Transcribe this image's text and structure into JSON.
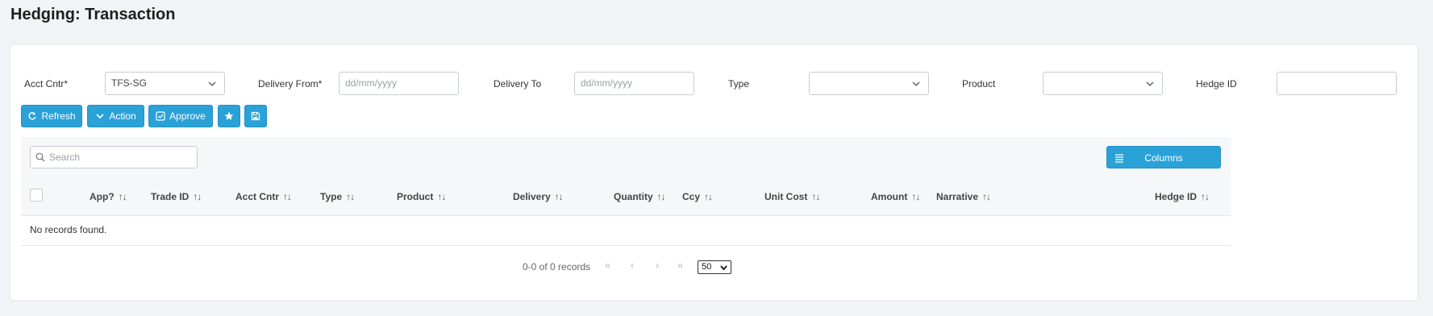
{
  "page": {
    "title": "Hedging: Transaction"
  },
  "filters": {
    "acct_cntr": {
      "label": "Acct Cntr*",
      "value": "TFS-SG"
    },
    "delivery_from": {
      "label": "Delivery From*",
      "placeholder": "dd/mm/yyyy"
    },
    "delivery_to": {
      "label": "Delivery To",
      "placeholder": "dd/mm/yyyy"
    },
    "type": {
      "label": "Type",
      "value": ""
    },
    "product": {
      "label": "Product",
      "value": ""
    },
    "hedge_id": {
      "label": "Hedge ID",
      "value": ""
    }
  },
  "toolbar": {
    "refresh": "Refresh",
    "action": "Action",
    "approve": "Approve",
    "favorite_icon": "star-icon",
    "save_icon": "save-icon"
  },
  "grid": {
    "search_placeholder": "Search",
    "columns_button": "Columns",
    "columns": [
      "App?",
      "Trade ID",
      "Acct Cntr",
      "Type",
      "Product",
      "Delivery",
      "Quantity",
      "Ccy",
      "Unit Cost",
      "Amount",
      "Narrative",
      "Hedge ID"
    ],
    "empty_message": "No records found.",
    "sortable": [
      true,
      true,
      true,
      true,
      true,
      true,
      true,
      true,
      true,
      true,
      true,
      true
    ]
  },
  "pager": {
    "summary": "0-0 of 0 records",
    "first": "«",
    "prev": "‹",
    "next": "›",
    "last": "»",
    "page_size": "50"
  },
  "colors": {
    "accent": "#2aa2d8",
    "background": "#f1f3f6",
    "panel": "#ffffff"
  }
}
